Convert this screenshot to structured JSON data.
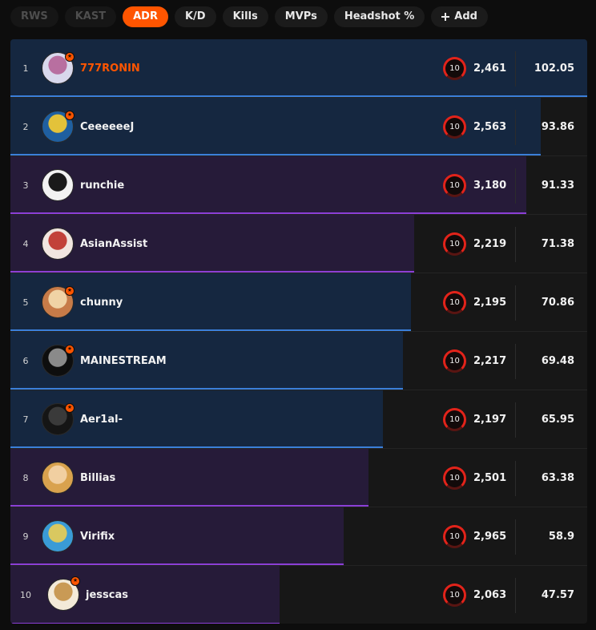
{
  "tabs": [
    {
      "label": "RWS",
      "state": "disabled"
    },
    {
      "label": "KAST",
      "state": "disabled"
    },
    {
      "label": "ADR",
      "state": "active"
    },
    {
      "label": "K/D",
      "state": "normal"
    },
    {
      "label": "Kills",
      "state": "normal"
    },
    {
      "label": "MVPs",
      "state": "normal"
    },
    {
      "label": "Headshot %",
      "state": "normal"
    },
    {
      "label": "Add",
      "state": "add",
      "icon": "plus-icon"
    }
  ],
  "colors": {
    "accent": "#ff5500",
    "blue_bar": "#152740",
    "blue_line": "#3b7fd9",
    "purple_bar": "#261b39",
    "purple_line": "#8b3fd6",
    "level_ring": "#e2231a"
  },
  "leaderboard": {
    "stat_max": 102.05,
    "rows": [
      {
        "rank": "1",
        "name": "777RONIN",
        "level": "10",
        "elo": "2,461",
        "stat": "102.05",
        "stat_value": 102.05,
        "bar": "blue",
        "badge": true,
        "highlight": true,
        "avatar_colors": [
          "#d8d8ec",
          "#b86fa0"
        ]
      },
      {
        "rank": "2",
        "name": "CeeeeeeJ",
        "level": "10",
        "elo": "2,563",
        "stat": "93.86",
        "stat_value": 93.86,
        "bar": "blue",
        "badge": true,
        "highlight": false,
        "avatar_colors": [
          "#1f5fa0",
          "#e3c23a"
        ]
      },
      {
        "rank": "3",
        "name": "runchie",
        "level": "10",
        "elo": "3,180",
        "stat": "91.33",
        "stat_value": 91.33,
        "bar": "purple",
        "badge": false,
        "highlight": false,
        "avatar_colors": [
          "#f2f2f2",
          "#1a1a1a"
        ]
      },
      {
        "rank": "4",
        "name": "AsianAssist",
        "level": "10",
        "elo": "2,219",
        "stat": "71.38",
        "stat_value": 71.38,
        "bar": "purple",
        "badge": false,
        "highlight": false,
        "avatar_colors": [
          "#f1e6e0",
          "#c2423a"
        ]
      },
      {
        "rank": "5",
        "name": "chunny",
        "level": "10",
        "elo": "2,195",
        "stat": "70.86",
        "stat_value": 70.86,
        "bar": "blue",
        "badge": true,
        "highlight": false,
        "avatar_colors": [
          "#c77b48",
          "#f0d3a5"
        ]
      },
      {
        "rank": "6",
        "name": "MAINESTREAM",
        "level": "10",
        "elo": "2,217",
        "stat": "69.48",
        "stat_value": 69.48,
        "bar": "blue",
        "badge": true,
        "highlight": false,
        "avatar_colors": [
          "#0e0e0e",
          "#8a8a8a"
        ]
      },
      {
        "rank": "7",
        "name": "Aer1al-",
        "level": "10",
        "elo": "2,197",
        "stat": "65.95",
        "stat_value": 65.95,
        "bar": "blue",
        "badge": true,
        "highlight": false,
        "avatar_colors": [
          "#151515",
          "#3a3a3a"
        ]
      },
      {
        "rank": "8",
        "name": "Billias",
        "level": "10",
        "elo": "2,501",
        "stat": "63.38",
        "stat_value": 63.38,
        "bar": "purple",
        "badge": false,
        "highlight": false,
        "avatar_colors": [
          "#d9a24e",
          "#f1cfa1"
        ]
      },
      {
        "rank": "9",
        "name": "Virifix",
        "level": "10",
        "elo": "2,965",
        "stat": "58.9",
        "stat_value": 58.9,
        "bar": "purple",
        "badge": false,
        "highlight": false,
        "avatar_colors": [
          "#3a9bd6",
          "#d9c860"
        ]
      },
      {
        "rank": "10",
        "name": "jesscas",
        "level": "10",
        "elo": "2,063",
        "stat": "47.57",
        "stat_value": 47.57,
        "bar": "purple",
        "badge": true,
        "highlight": false,
        "avatar_colors": [
          "#f3ead8",
          "#c99a55"
        ]
      }
    ]
  }
}
